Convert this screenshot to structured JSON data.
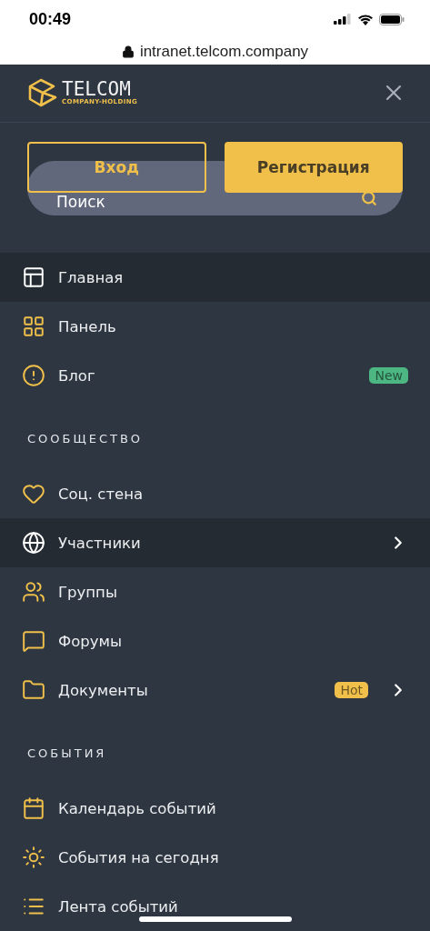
{
  "status_bar": {
    "time": "00:49"
  },
  "address_bar": {
    "url": "intranet.telcom.company"
  },
  "logo": {
    "name": "TELCOM",
    "tagline": "COMPANY-HOLDING"
  },
  "auth_buttons": [
    {
      "label": "Вход",
      "kind": "outline"
    },
    {
      "label": "Регистрация",
      "kind": "filled"
    }
  ],
  "search": {
    "placeholder": "Поиск"
  },
  "sections": [
    {
      "items": [
        {
          "label": "Главная",
          "selected": true,
          "submenu": false
        },
        {
          "label": "Панель",
          "selected": false,
          "submenu": false
        },
        {
          "label": "Блог",
          "selected": false,
          "submenu": false,
          "badge": {
            "text": "New",
            "color": "#4cb782"
          }
        }
      ]
    },
    {
      "title": "СООБЩЕСТВО",
      "items": [
        {
          "label": "Соц. стена",
          "selected": false,
          "submenu": false
        },
        {
          "label": "Участники",
          "selected": true,
          "submenu": true
        },
        {
          "label": "Группы",
          "selected": false,
          "submenu": false
        },
        {
          "label": "Форумы",
          "selected": false,
          "submenu": false
        },
        {
          "label": "Документы",
          "selected": false,
          "submenu": true,
          "badge": {
            "text": "Hot",
            "color": "#f0c04a"
          }
        }
      ]
    },
    {
      "title": "СОБЫТИЯ",
      "items": [
        {
          "label": "Календарь событий",
          "selected": false,
          "submenu": false
        },
        {
          "label": "События на сегодня",
          "selected": false,
          "submenu": false
        },
        {
          "label": "Лента событий",
          "selected": false,
          "submenu": false
        }
      ]
    }
  ]
}
